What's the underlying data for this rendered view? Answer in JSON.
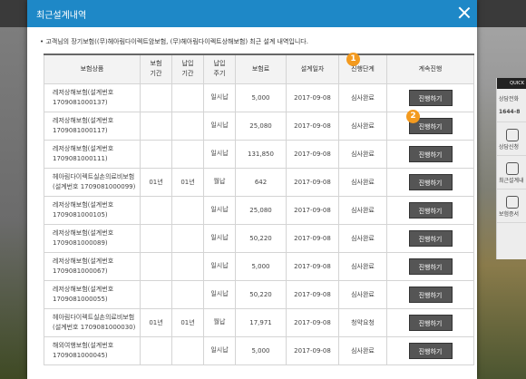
{
  "modal": {
    "title": "최근설계내역",
    "notice": "고객님의 장기보험((무)헤아림다이렉트암보험, (무)헤아림다이렉트상해보험) 최근 설계 내역입니다."
  },
  "markers": [
    "1",
    "2"
  ],
  "table": {
    "headers": {
      "product": "보험상품",
      "period": "보험\n기간",
      "pay_period": "납입\n기간",
      "pay_cycle": "납입\n주기",
      "premium": "보험료",
      "date": "설계일자",
      "status": "진행단계",
      "action": "계속진행"
    },
    "rows": [
      {
        "product": "레저상해보험(설계번호 1709081000137)",
        "period": "",
        "pay_period": "",
        "pay_cycle": "일시납",
        "premium": "5,000",
        "date": "2017-09-08",
        "status": "심사완료",
        "action": "진행하기"
      },
      {
        "product": "레저상해보험(설계번호 1709081000117)",
        "period": "",
        "pay_period": "",
        "pay_cycle": "일시납",
        "premium": "25,080",
        "date": "2017-09-08",
        "status": "심사완료",
        "action": "진행하기"
      },
      {
        "product": "레저상해보험(설계번호 1709081000111)",
        "period": "",
        "pay_period": "",
        "pay_cycle": "일시납",
        "premium": "131,850",
        "date": "2017-09-08",
        "status": "심사완료",
        "action": "진행하기"
      },
      {
        "product": "헤아림다이렉트실손의료비보험(설계번호 1709081000099)",
        "period": "01년",
        "pay_period": "01년",
        "pay_cycle": "월납",
        "premium": "642",
        "date": "2017-09-08",
        "status": "심사완료",
        "action": "진행하기"
      },
      {
        "product": "레저상해보험(설계번호 1709081000105)",
        "period": "",
        "pay_period": "",
        "pay_cycle": "일시납",
        "premium": "25,080",
        "date": "2017-09-08",
        "status": "심사완료",
        "action": "진행하기"
      },
      {
        "product": "레저상해보험(설계번호 1709081000089)",
        "period": "",
        "pay_period": "",
        "pay_cycle": "일시납",
        "premium": "50,220",
        "date": "2017-09-08",
        "status": "심사완료",
        "action": "진행하기"
      },
      {
        "product": "레저상해보험(설계번호 1709081000067)",
        "period": "",
        "pay_period": "",
        "pay_cycle": "일시납",
        "premium": "5,000",
        "date": "2017-09-08",
        "status": "심사완료",
        "action": "진행하기"
      },
      {
        "product": "레저상해보험(설계번호 1709081000055)",
        "period": "",
        "pay_period": "",
        "pay_cycle": "일시납",
        "premium": "50,220",
        "date": "2017-09-08",
        "status": "심사완료",
        "action": "진행하기"
      },
      {
        "product": "헤아림다이렉트실손의료비보험(설계번호 1709081000030)",
        "period": "01년",
        "pay_period": "01년",
        "pay_cycle": "월납",
        "premium": "17,971",
        "date": "2017-09-08",
        "status": "청약요청",
        "action": "진행하기"
      },
      {
        "product": "해외여행보험(설계번호 1709081000045)",
        "period": "",
        "pay_period": "",
        "pay_cycle": "일시납",
        "premium": "5,000",
        "date": "2017-09-08",
        "status": "심사완료",
        "action": "진행하기"
      }
    ]
  },
  "quick_menu": {
    "title": "QUICK",
    "items": [
      "상담전화",
      "1644-8",
      "상담신청",
      "최근설계내",
      "보험증서"
    ]
  },
  "colors": {
    "header_blue": "#1e88c7",
    "marker_orange": "#f39a1f",
    "button_gray": "#555555"
  }
}
